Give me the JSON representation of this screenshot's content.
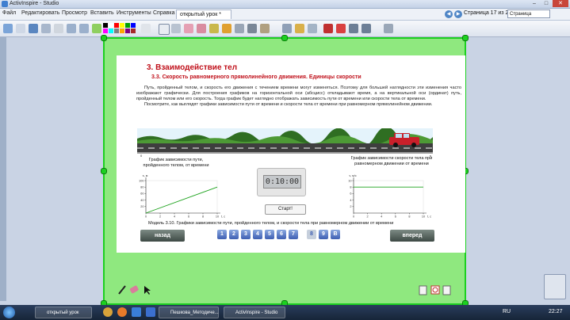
{
  "window": {
    "title": "ActivInspire - Studio"
  },
  "menu": {
    "items": [
      "Файл",
      "Редактировать",
      "Просмотр",
      "Вставить",
      "Инструменты",
      "Справка"
    ],
    "active_tab": "открытый урок *",
    "page_counter": "Страница 17 из 25",
    "zoom_value": "Страница целиком"
  },
  "colors": {
    "canvas_bg": "#8fe87f",
    "canvas_border": "#1cd020",
    "heading": "#c0101a",
    "page_button": "#3e5fb2",
    "nav_button": "#4a5550"
  },
  "palette": [
    "#000000",
    "#ffffff",
    "#ff0000",
    "#ffff00",
    "#00a000",
    "#0000ff",
    "#ff00ff",
    "#00ffff",
    "#808080",
    "#ffa500",
    "#800080",
    "#a52a2a"
  ],
  "slide": {
    "heading": "3. Взаимодействие тел",
    "subheading": "3.3. Скорость равномерного прямолинейного движения. Единицы скорости",
    "paragraph1": "Путь, пройденный телом, и скорость его движения с течением времени могут изменяться. Поэтому для большей наглядности эти изменения часто изображают графически. Для построения графиков на горизонтальной оси (абсцисс) откладывают время, а на вертикальной оси (ординат) путь, пройденный телом или его скорость. Тогда график будет наглядно отображать зависимость пути от времени или скорости тела от времени.",
    "paragraph2": "Посмотрите, как выглядят графики зависимости пути от времени и скорости тела от времени при равномерном прямолинейном движении.",
    "label_path": "График зависимости пути, пройденного телом, от времени",
    "label_speed": "График зависимости скорости тела при равномерном движении от времени",
    "timer": "0:10:00",
    "start_label": "Старт!",
    "caption": "Модель 3.10. Графики зависимости пути, пройденного телом, и скорости тела при равномерном движении от времени",
    "back_label": "назад",
    "forward_label": "вперед",
    "pages": [
      "1",
      "2",
      "3",
      "4",
      "5",
      "6",
      "7",
      "8",
      "9",
      "В"
    ],
    "active_page": "8",
    "road_scale_start": "0",
    "road_scale_end": "s"
  },
  "chart_data": [
    {
      "type": "line",
      "title": "",
      "xlabel": "t, c",
      "ylabel": "s, м",
      "xlim": [
        0,
        10
      ],
      "ylim": [
        0,
        100
      ],
      "x_ticks": [
        "0",
        "2",
        "4",
        "6",
        "8",
        "10"
      ],
      "y_ticks": [
        "20",
        "40",
        "60",
        "80",
        "100"
      ],
      "series": [
        {
          "x": [
            0,
            10
          ],
          "values": [
            0,
            80
          ]
        }
      ]
    },
    {
      "type": "line",
      "title": "",
      "xlabel": "t, c",
      "ylabel": "v, м/с",
      "xlim": [
        0,
        10
      ],
      "ylim": [
        0,
        10
      ],
      "x_ticks": [
        "0",
        "2",
        "4",
        "6",
        "8",
        "10"
      ],
      "y_ticks": [
        "2",
        "4",
        "6",
        "8",
        "10"
      ],
      "series": [
        {
          "x": [
            0,
            10
          ],
          "values": [
            8,
            8
          ]
        }
      ]
    }
  ],
  "taskbar": {
    "tasks": [
      "открытый урок",
      "Пешкова_Методиче...",
      "ActivInspire - Studio"
    ],
    "language": "RU",
    "time": "22:27"
  }
}
